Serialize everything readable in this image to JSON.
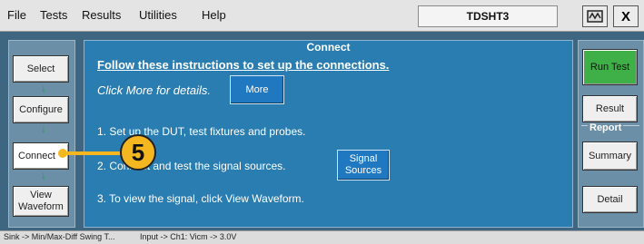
{
  "menubar": {
    "items": [
      "File",
      "Tests",
      "Results",
      "Utilities",
      "Help"
    ],
    "app_name": "TDSHT3",
    "minimize_icon": "oscilloscope-minimize-icon",
    "close_label": "X"
  },
  "steps": [
    {
      "label": "Select"
    },
    {
      "label": "Configure"
    },
    {
      "label": "Connect",
      "active": true
    },
    {
      "label": "View Waveform"
    }
  ],
  "main": {
    "title": "Connect",
    "instructions_heading": "Follow these instructions to set up the connections.",
    "hint": "Click More for details.",
    "more_button": "More",
    "step1": "1. Set up the DUT, test fixtures and probes.",
    "step2": "2. Connect and test the signal sources.",
    "signal_sources_button": "Signal Sources",
    "step3": "3. To view the signal, click View Waveform."
  },
  "right": {
    "run_test": "Run Test",
    "result": "Result",
    "report_label": "Report",
    "summary": "Summary",
    "detail": "Detail"
  },
  "status": {
    "test": "Sink -> Min/Max-Diff Swing T...",
    "input": "Input -> Ch1: Vicm -> 3.0V"
  },
  "callout": {
    "number": "5"
  },
  "colors": {
    "accent_green": "#3fb047",
    "callout_yellow": "#f5b720",
    "panel_blue": "#2a7db0"
  }
}
